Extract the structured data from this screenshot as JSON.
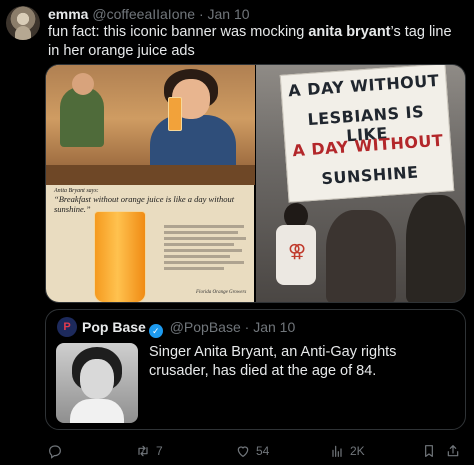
{
  "tweet": {
    "author_name": "emma",
    "author_handle": "@coffeeaIIaIone",
    "separator": "·",
    "time": "Jan 10",
    "text_before": "fun fact: this iconic banner was mocking ",
    "text_bold": "anita bryant",
    "text_after": "’s tag line in her orange juice ads"
  },
  "media": {
    "ad": {
      "caption_small": "Anita Bryant says:",
      "caption_quote": "“Breakfast without orange juice is like a day without sunshine.”",
      "brand": "Florida Orange Growers"
    },
    "banner": {
      "line1": "A DAY WITHOUT",
      "line2": "LESBIANS IS LIKE",
      "line3": "A DAY WITHOUT",
      "line4": "SUNSHINE"
    }
  },
  "quote": {
    "name": "Pop Base",
    "handle": "@PopBase",
    "separator": "·",
    "time": "Jan 10",
    "text": "Singer Anita Bryant, an Anti-Gay rights crusader, has died at the age of 84."
  },
  "actions": {
    "reply_count": "",
    "retweet_count": "7",
    "like_count": "54",
    "views_count": "2K"
  },
  "colors": {
    "background": "#000000",
    "text": "#e7e9ea",
    "muted": "#71767b",
    "border": "#2f3336",
    "verified": "#1d9bf0"
  }
}
